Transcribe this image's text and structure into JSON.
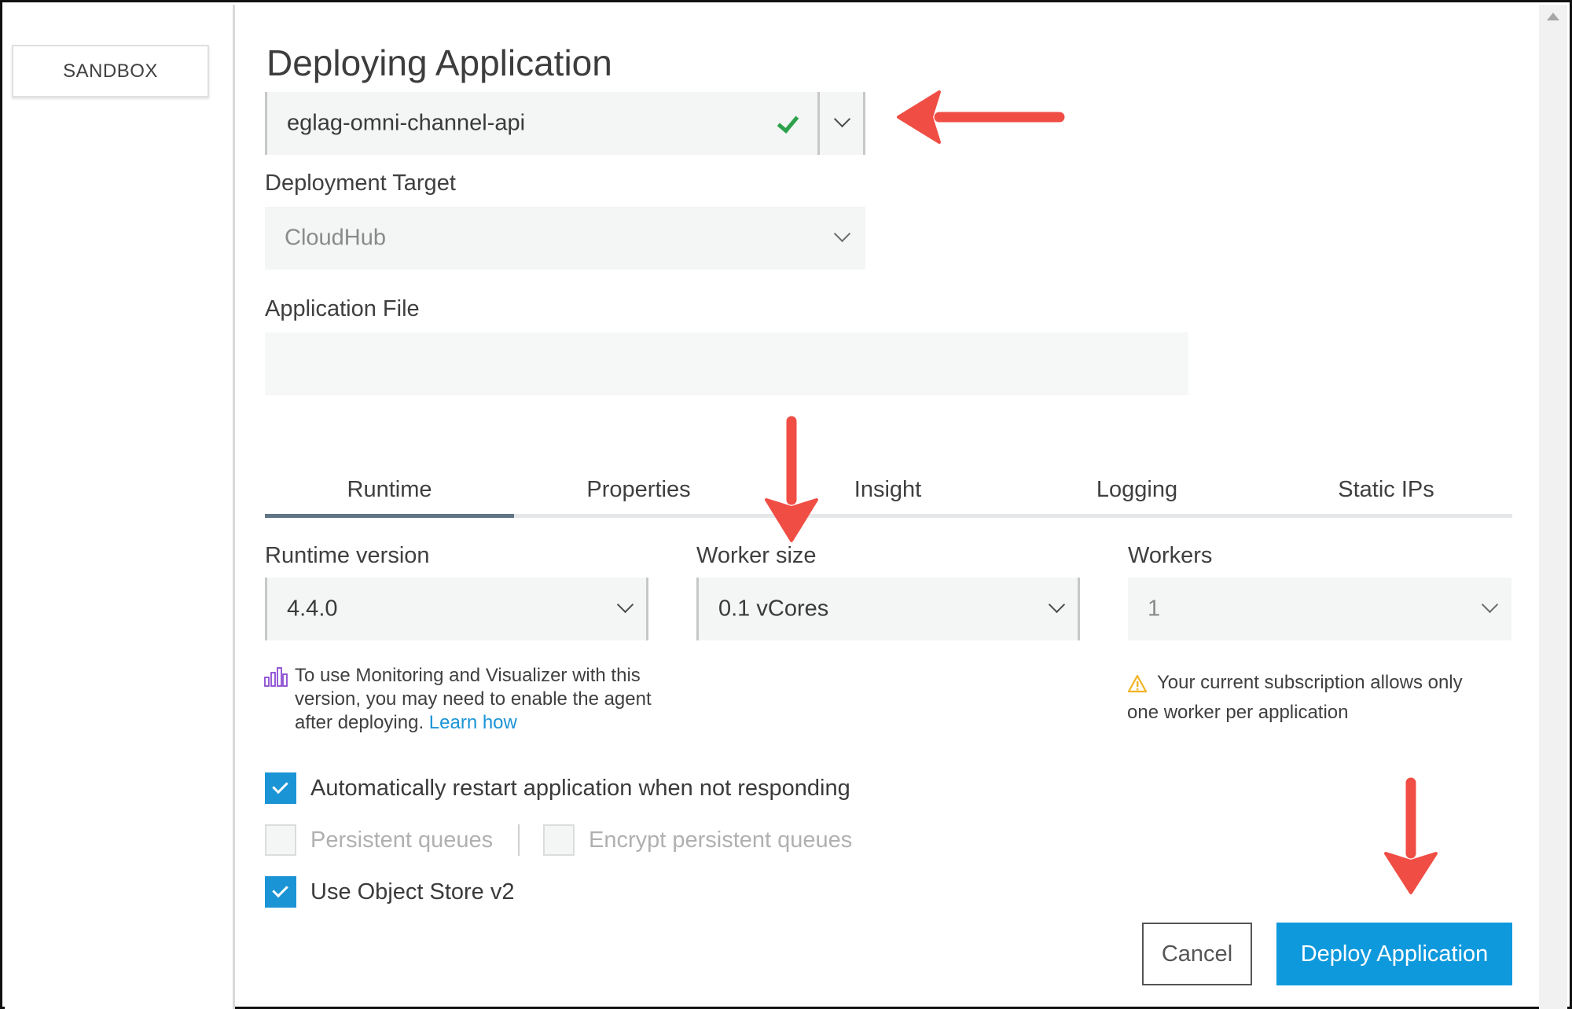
{
  "sidebar": {
    "environment_label": "SANDBOX"
  },
  "page_title": "Deploying Application",
  "application": {
    "value": "eglag-omni-channel-api",
    "status": "valid"
  },
  "deployment_target": {
    "label": "Deployment Target",
    "value": "CloudHub"
  },
  "application_file": {
    "label": "Application File",
    "value": ""
  },
  "tabs": [
    {
      "label": "Runtime",
      "active": true
    },
    {
      "label": "Properties",
      "active": false
    },
    {
      "label": "Insight",
      "active": false
    },
    {
      "label": "Logging",
      "active": false
    },
    {
      "label": "Static IPs",
      "active": false
    }
  ],
  "runtime": {
    "runtime_version": {
      "label": "Runtime version",
      "value": "4.4.0"
    },
    "worker_size": {
      "label": "Worker size",
      "value": "0.1 vCores"
    },
    "workers": {
      "label": "Workers",
      "value": "1"
    },
    "monitoring_note": "To use Monitoring and Visualizer with this version, you may need to enable the agent after deploying.",
    "learn_how_link": "Learn how",
    "subscription_warning": "Your current subscription allows only one worker per application"
  },
  "options": {
    "auto_restart": {
      "label": "Automatically restart application when not responding",
      "checked": true
    },
    "persistent_queues": {
      "label": "Persistent queues",
      "checked": false,
      "disabled": true
    },
    "encrypt_persistent_queues": {
      "label": "Encrypt persistent queues",
      "checked": false,
      "disabled": true
    },
    "object_store_v2": {
      "label": "Use Object Store v2",
      "checked": true
    }
  },
  "actions": {
    "cancel_label": "Cancel",
    "deploy_label": "Deploy Application"
  },
  "colors": {
    "primary_blue": "#0f99dd",
    "success_green": "#2ca24b",
    "warning_yellow": "#f0b323",
    "annotation_red": "#f04e45",
    "active_tab": "#5f7585"
  }
}
